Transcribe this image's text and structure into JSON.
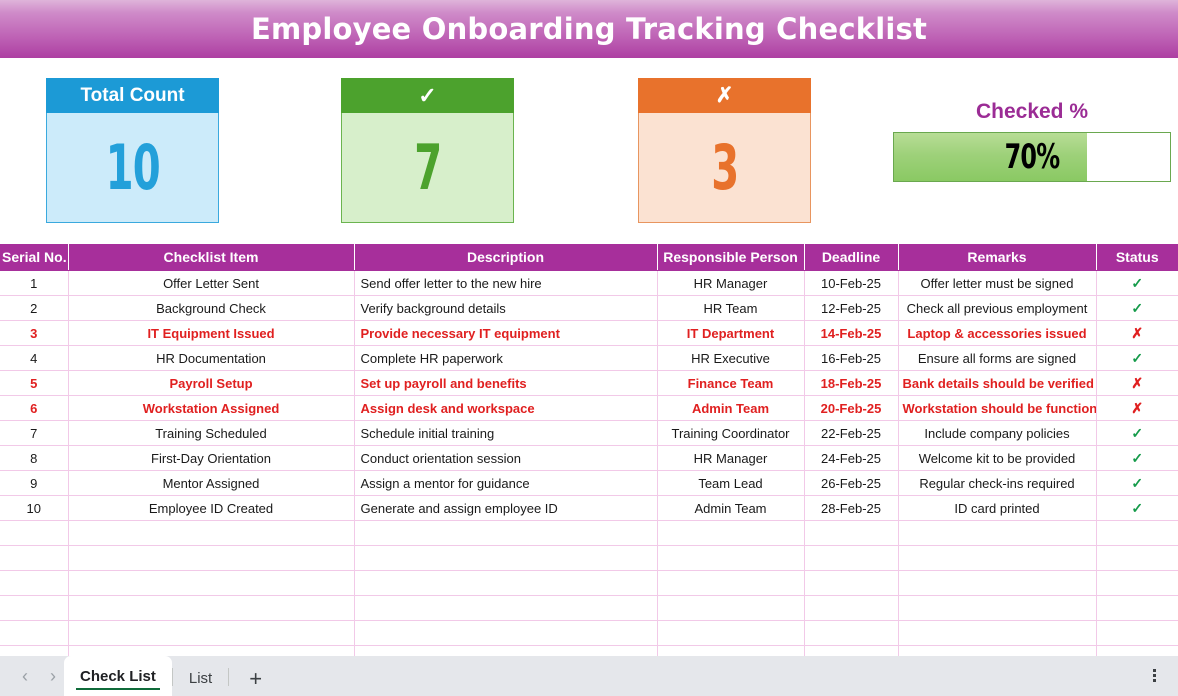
{
  "header": {
    "title": "Employee Onboarding Tracking Checklist"
  },
  "kpi": {
    "total": {
      "label": "Total Count",
      "value": "10",
      "head_color": "#1C9AD6",
      "body_color": "#CCEBFA"
    },
    "completed": {
      "label": "✓",
      "icon_name": "check-icon",
      "value": "7",
      "head_color": "#4CA22D",
      "body_color": "#D7EFCB"
    },
    "pending": {
      "label": "✗",
      "icon_name": "cross-icon",
      "value": "3",
      "head_color": "#E8722C",
      "body_color": "#FBE2D2"
    },
    "gauge": {
      "label": "Checked %",
      "value": "70%",
      "percent": 70,
      "fill_color": "#9ED17A",
      "label_color": "#9B2C95"
    }
  },
  "table": {
    "columns": [
      "Serial No.",
      "Checklist Item",
      "Description",
      "Responsible Person",
      "Deadline",
      "Remarks",
      "Status"
    ],
    "header_color": "#A72F9B",
    "flag_color": "#E02020",
    "rows": [
      {
        "serial": "1",
        "item": "Offer Letter Sent",
        "description": "Send offer letter to the new hire",
        "responsible": "HR Manager",
        "deadline": "10-Feb-25",
        "remarks": "Offer letter must be signed",
        "status": "✓",
        "status_name": "check-icon",
        "flagged": false
      },
      {
        "serial": "2",
        "item": "Background Check",
        "description": "Verify background details",
        "responsible": "HR Team",
        "deadline": "12-Feb-25",
        "remarks": "Check all previous employment",
        "status": "✓",
        "status_name": "check-icon",
        "flagged": false
      },
      {
        "serial": "3",
        "item": "IT Equipment Issued",
        "description": "Provide necessary IT equipment",
        "responsible": "IT Department",
        "deadline": "14-Feb-25",
        "remarks": "Laptop & accessories issued",
        "status": "✗",
        "status_name": "cross-icon",
        "flagged": true
      },
      {
        "serial": "4",
        "item": "HR Documentation",
        "description": "Complete HR paperwork",
        "responsible": "HR Executive",
        "deadline": "16-Feb-25",
        "remarks": "Ensure all forms are signed",
        "status": "✓",
        "status_name": "check-icon",
        "flagged": false
      },
      {
        "serial": "5",
        "item": "Payroll Setup",
        "description": "Set up payroll and benefits",
        "responsible": "Finance Team",
        "deadline": "18-Feb-25",
        "remarks": "Bank details should be verified",
        "status": "✗",
        "status_name": "cross-icon",
        "flagged": true
      },
      {
        "serial": "6",
        "item": "Workstation Assigned",
        "description": "Assign desk and workspace",
        "responsible": "Admin Team",
        "deadline": "20-Feb-25",
        "remarks": "Workstation should be functional",
        "status": "✗",
        "status_name": "cross-icon",
        "flagged": true
      },
      {
        "serial": "7",
        "item": "Training Scheduled",
        "description": "Schedule initial training",
        "responsible": "Training Coordinator",
        "deadline": "22-Feb-25",
        "remarks": "Include company policies",
        "status": "✓",
        "status_name": "check-icon",
        "flagged": false
      },
      {
        "serial": "8",
        "item": "First-Day Orientation",
        "description": "Conduct orientation session",
        "responsible": "HR Manager",
        "deadline": "24-Feb-25",
        "remarks": "Welcome kit to be provided",
        "status": "✓",
        "status_name": "check-icon",
        "flagged": false
      },
      {
        "serial": "9",
        "item": "Mentor Assigned",
        "description": "Assign a mentor for guidance",
        "responsible": "Team Lead",
        "deadline": "26-Feb-25",
        "remarks": "Regular check-ins required",
        "status": "✓",
        "status_name": "check-icon",
        "flagged": false
      },
      {
        "serial": "10",
        "item": "Employee ID Created",
        "description": "Generate and assign employee ID",
        "responsible": "Admin Team",
        "deadline": "28-Feb-25",
        "remarks": "ID card printed",
        "status": "✓",
        "status_name": "check-icon",
        "flagged": false
      }
    ],
    "empty_row_count": 6
  },
  "tabbar": {
    "prev_label": "‹",
    "next_label": "›",
    "add_label": "+",
    "tabs": [
      {
        "label": "Check List",
        "active": true
      },
      {
        "label": "List",
        "active": false
      }
    ]
  }
}
